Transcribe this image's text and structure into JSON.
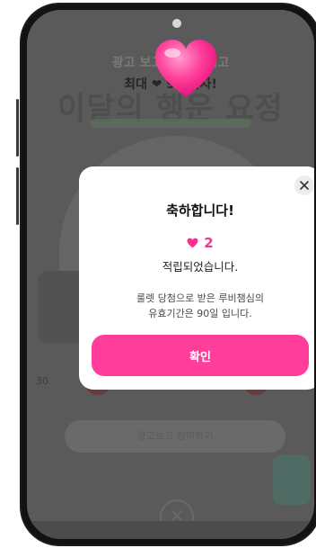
{
  "background": {
    "line1": "광고 보고 룰렛 돌리고",
    "line2": "최대 ❤ 90 받자!",
    "headline": "이달의 행운 요정",
    "pill_button": "광고보고 참여하기",
    "side_label": "30"
  },
  "modal": {
    "title": "축하합니다!",
    "reward_count": "2",
    "reward_text": "적립되었습니다.",
    "info_line1": "룰렛 당첨으로 받은 루비챔심의",
    "info_line2": "유효기간은 90일 입니다.",
    "confirm_label": "확인",
    "close_icon": "close-icon"
  },
  "colors": {
    "accent": "#ff3d9a",
    "heart": "#ff2f8f",
    "dim_overlay": "#5a5a5a"
  }
}
